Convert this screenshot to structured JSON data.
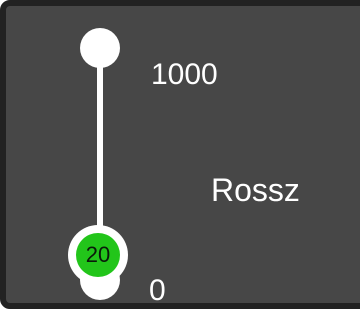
{
  "slider": {
    "max_label": "1000",
    "min_label": "0",
    "max": 1000,
    "min": 0,
    "value": 20,
    "value_label": "20",
    "thumb_color": "#22c51a"
  },
  "rating_label": "Rossz"
}
